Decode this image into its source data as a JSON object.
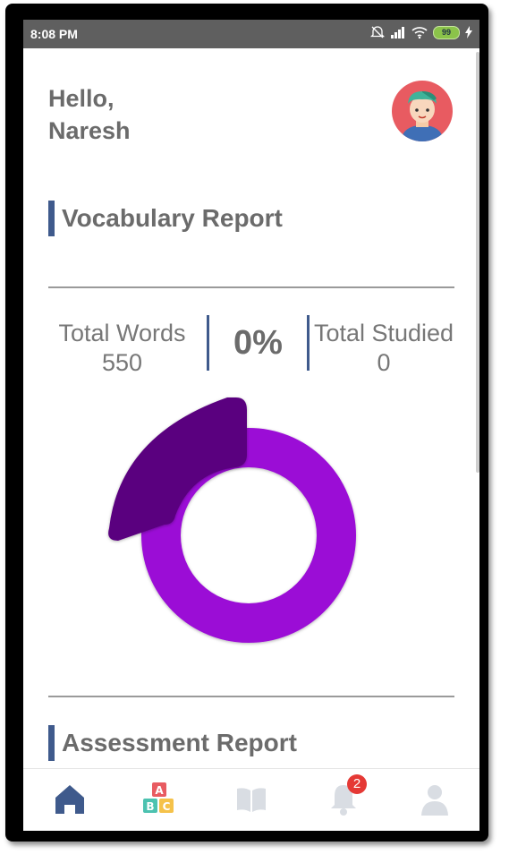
{
  "status_bar": {
    "time": "8:08 PM",
    "battery": "99"
  },
  "header": {
    "greeting_line1": "Hello,",
    "greeting_line2": "Naresh"
  },
  "vocabulary": {
    "title": "Vocabulary Report",
    "total_words_label": "Total Words",
    "total_words_value": "550",
    "percent": "0%",
    "total_studied_label": "Total Studied",
    "total_studied_value": "0",
    "colors": {
      "studied": "#5a067f",
      "remaining": "#9b0fd6"
    }
  },
  "assessment": {
    "title": "Assessment Report"
  },
  "nav": {
    "items": [
      "home-icon",
      "abc-blocks-icon",
      "book-icon",
      "bell-icon",
      "profile-icon"
    ],
    "notification_count": "2",
    "active_color": "#3f5a8c"
  }
}
